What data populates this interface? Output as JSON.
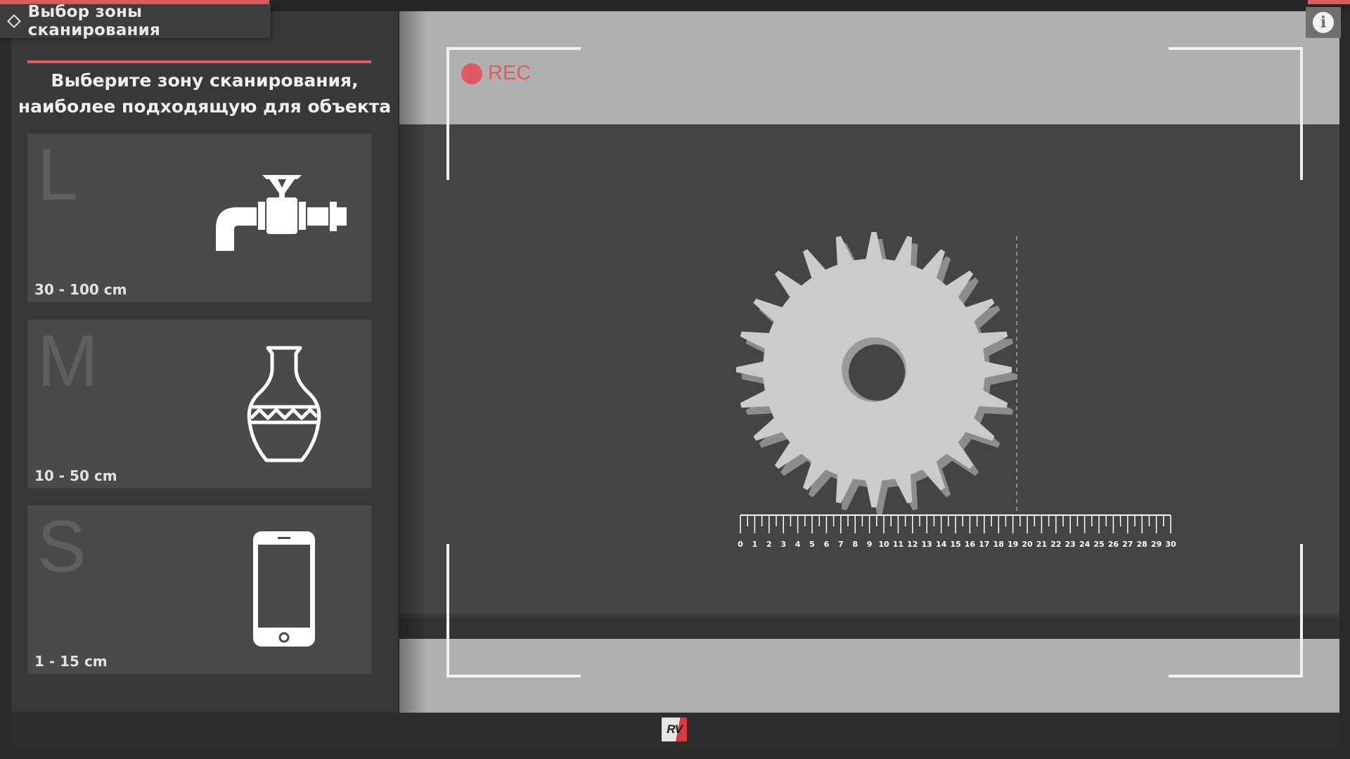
{
  "header": {
    "title": "Выбор зоны сканирования"
  },
  "panel": {
    "instruction_line1": "Выберите зону сканирования,",
    "instruction_line2": "наиболее подходящую для объекта"
  },
  "zones": [
    {
      "letter": "L",
      "range": "30 - 100 cm",
      "icon": "pipe-valve-icon"
    },
    {
      "letter": "M",
      "range": "10 - 50 cm",
      "icon": "vase-icon"
    },
    {
      "letter": "S",
      "range": "1 - 15 cm",
      "icon": "smartphone-icon"
    }
  ],
  "viewport": {
    "rec_label": "REC",
    "object_icon": "gear-icon",
    "ruler": {
      "min": 0,
      "max": 30,
      "labels": [
        "0",
        "1",
        "2",
        "3",
        "4",
        "5",
        "6",
        "7",
        "8",
        "9",
        "10",
        "11",
        "12",
        "13",
        "14",
        "15",
        "16",
        "17",
        "18",
        "19",
        "20",
        "21",
        "22",
        "23",
        "24",
        "25",
        "26",
        "27",
        "28",
        "29",
        "30"
      ]
    }
  },
  "info_button": {
    "icon": "info-icon"
  },
  "footer": {
    "logo_text": "RV"
  },
  "colors": {
    "accent": "#e05a5f",
    "panel": "#383838",
    "card": "#4a4a4a",
    "viewport": "#444444",
    "band": "#b0b0b0"
  }
}
